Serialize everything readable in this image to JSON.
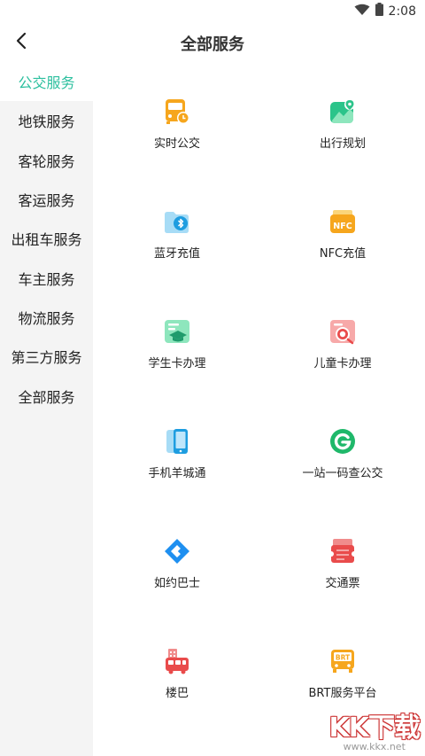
{
  "status_bar": {
    "time": "2:08"
  },
  "header": {
    "title": "全部服务"
  },
  "sidebar": {
    "items": [
      {
        "label": "公交服务"
      },
      {
        "label": "地铁服务"
      },
      {
        "label": "客轮服务"
      },
      {
        "label": "客运服务"
      },
      {
        "label": "出租车服务"
      },
      {
        "label": "车主服务"
      },
      {
        "label": "物流服务"
      },
      {
        "label": "第三方服务"
      },
      {
        "label": "全部服务"
      }
    ],
    "active_index": 0
  },
  "services": [
    {
      "label": "实时公交",
      "icon": "bus-icon"
    },
    {
      "label": "出行规划",
      "icon": "map-pin-icon"
    },
    {
      "label": "蓝牙充值",
      "icon": "bluetooth-folder-icon"
    },
    {
      "label": "NFC充值",
      "icon": "nfc-wallet-icon"
    },
    {
      "label": "学生卡办理",
      "icon": "graduation-card-icon"
    },
    {
      "label": "儿童卡办理",
      "icon": "child-card-icon"
    },
    {
      "label": "手机羊城通",
      "icon": "phone-icon"
    },
    {
      "label": "一站一码查公交",
      "icon": "g-circle-icon"
    },
    {
      "label": "如约巴士",
      "icon": "diamond-logo-icon"
    },
    {
      "label": "交通票",
      "icon": "ticket-icon"
    },
    {
      "label": "楼巴",
      "icon": "building-bus-icon"
    },
    {
      "label": "BRT服务平台",
      "icon": "brt-bus-icon"
    }
  ],
  "watermark": {
    "logo": "KK下载",
    "url": "www.kkx.net"
  },
  "colors": {
    "accent": "#2bbf9e",
    "sidebar_bg": "#f4f4f4"
  }
}
